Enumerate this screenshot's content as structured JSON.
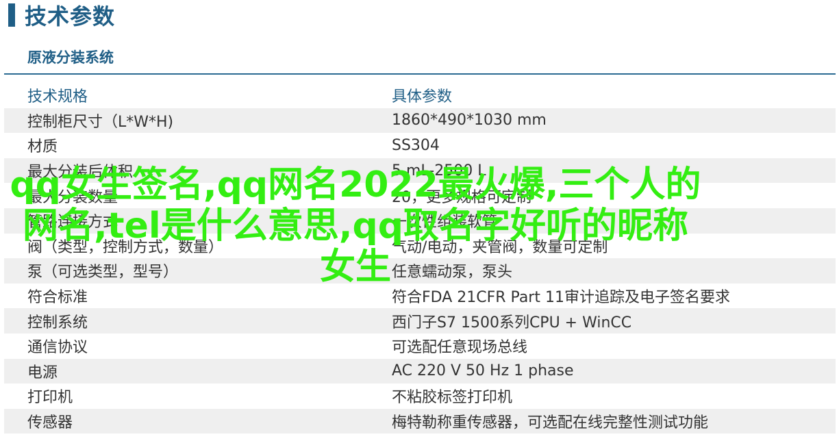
{
  "page": {
    "title": "技术参数",
    "subtitle": "原液分装系统"
  },
  "table": {
    "header": {
      "key": "技术规格",
      "value": "具体参数"
    },
    "rows": [
      {
        "key": "控制柜尺寸（L*W*H)",
        "value": "1860*490*1030 mm"
      },
      {
        "key": "材质",
        "value": "SS304"
      },
      {
        "key": "最大分装后体积",
        "value": "5 mL-2500 L"
      },
      {
        "key": "最大分装数量",
        "value": "20，更多规格可定制"
      },
      {
        "key": "管路连接方式",
        "value": "一次性组装软管"
      },
      {
        "key": "阀（类型，控制方式，数量）",
        "value": "气动/电动，夹管阀，数量可定制"
      },
      {
        "key": "泵（可选类型，型号）",
        "value": "任意蠕动泵，泵头"
      },
      {
        "key": "符合标准",
        "value": "符合FDA 21CFR Part 11审计追踪及电子签名要求"
      },
      {
        "key": "控制系统",
        "value": "西门子S7 1500系列CPU + WinCC"
      },
      {
        "key": "通信协议",
        "value": "可选配任意现场总线"
      },
      {
        "key": "电源",
        "value": "AC 220 V 50 Hz 1 phase"
      },
      {
        "key": "打印机",
        "value": "不粘胶标签打印机"
      },
      {
        "key": "传感器",
        "value": "梅特勒称重传感器，可选配在线完整性测试功能"
      }
    ]
  },
  "watermark": {
    "text": "qq女生签名,qq网名2022最火爆,三个人的网名,tel是什么意思,qq取名字好听的昵称女生"
  },
  "colors": {
    "accent": "#1f5e86",
    "rule": "#2a6a92",
    "row_shade": "#efefef",
    "text": "#333333",
    "watermark": "#33ee12"
  }
}
